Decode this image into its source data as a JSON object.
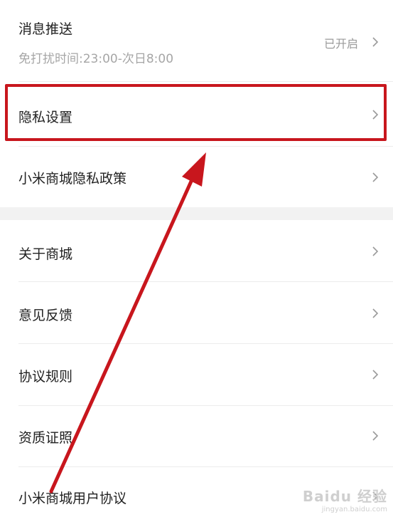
{
  "settings": {
    "push": {
      "title": "消息推送",
      "subtitle": "免打扰时间:23:00-次日8:00",
      "status": "已开启"
    },
    "items": [
      {
        "label": "隐私设置"
      },
      {
        "label": "小米商城隐私政策"
      },
      {
        "label": "关于商城"
      },
      {
        "label": "意见反馈"
      },
      {
        "label": "协议规则"
      },
      {
        "label": "资质证照"
      },
      {
        "label": "小米商城用户协议"
      }
    ]
  },
  "annotation": {
    "highlight_color": "#c8161d",
    "arrow_color": "#c8161d"
  },
  "watermark": {
    "text": "Baidu 经验",
    "sub": "jingyan.baidu.com"
  },
  "icons": {
    "chevron": "chevron-right-icon"
  }
}
